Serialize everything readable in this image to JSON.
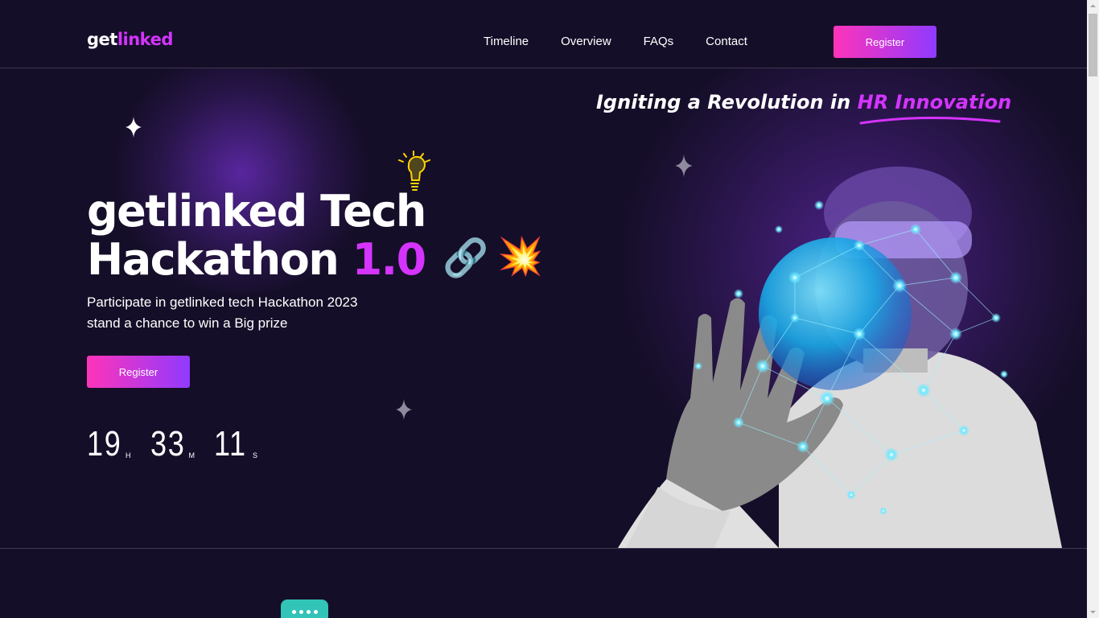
{
  "header": {
    "logo_part1": "get",
    "logo_part2": "linked",
    "nav": [
      "Timeline",
      "Overview",
      "FAQs",
      "Contact"
    ],
    "register_label": "Register"
  },
  "hero": {
    "tagline_part1": "Igniting a Revolution in ",
    "tagline_highlight": "HR Innovation",
    "title_line1": "getlinked Tech",
    "title_line2": "Hackathon ",
    "title_version": "1.0",
    "emoji_link": "🔗",
    "emoji_burst": "💥",
    "subtitle_line1": "Participate in getlinked tech Hackathon 2023",
    "subtitle_line2": "stand a chance to win a Big prize",
    "register_label": "Register",
    "timer": {
      "hours": "19",
      "hours_unit": "H",
      "minutes": "33",
      "minutes_unit": "M",
      "seconds": "11",
      "seconds_unit": "S"
    }
  },
  "colors": {
    "background": "#150e28",
    "accent": "#d434fe",
    "button_gradient_start": "#fe34b9",
    "button_gradient_end": "#903aff",
    "chat_bubble": "#32c4b7"
  },
  "icons": [
    "sparkle-star-icon",
    "lightbulb-icon",
    "link-chain-icon",
    "explosion-icon",
    "chat-bubble-icon"
  ]
}
